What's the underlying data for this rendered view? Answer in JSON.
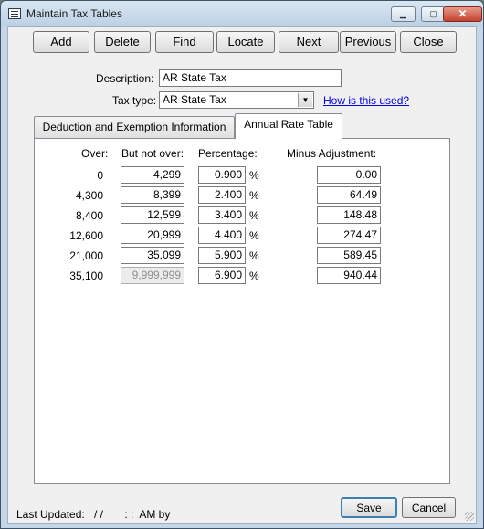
{
  "window": {
    "title": "Maintain Tax Tables",
    "minimize_icon": "minimize-icon",
    "maximize_icon": "maximize-icon",
    "close_icon": "close-icon"
  },
  "toolbar": {
    "add": "Add",
    "delete": "Delete",
    "find": "Find",
    "locate": "Locate",
    "next": "Next",
    "previous": "Previous",
    "close": "Close"
  },
  "form": {
    "description_label": "Description:",
    "description_value": "AR State Tax",
    "tax_type_label": "Tax type:",
    "tax_type_value": "AR State Tax",
    "help_link": "How is this used?"
  },
  "tabs": [
    {
      "label": "Deduction and Exemption Information"
    },
    {
      "label": "Annual Rate Table"
    }
  ],
  "rate_table": {
    "headers": {
      "over": "Over:",
      "but_not_over": "But not over:",
      "percentage": "Percentage:",
      "minus_adjustment": "Minus Adjustment:"
    },
    "percent_sign": "%",
    "rows": [
      {
        "over": "0",
        "but_not_over": "4,299",
        "percentage": "0.900",
        "minus_adjustment": "0.00"
      },
      {
        "over": "4,300",
        "but_not_over": "8,399",
        "percentage": "2.400",
        "minus_adjustment": "64.49"
      },
      {
        "over": "8,400",
        "but_not_over": "12,599",
        "percentage": "3.400",
        "minus_adjustment": "148.48"
      },
      {
        "over": "12,600",
        "but_not_over": "20,999",
        "percentage": "4.400",
        "minus_adjustment": "274.47"
      },
      {
        "over": "21,000",
        "but_not_over": "35,099",
        "percentage": "5.900",
        "minus_adjustment": "589.45"
      },
      {
        "over": "35,100",
        "but_not_over": "9,999,999",
        "percentage": "6.900",
        "minus_adjustment": "940.44"
      }
    ]
  },
  "footer": {
    "last_updated_label": "Last Updated:",
    "last_updated_value": "/ /       : :  AM by",
    "save": "Save",
    "cancel": "Cancel"
  }
}
